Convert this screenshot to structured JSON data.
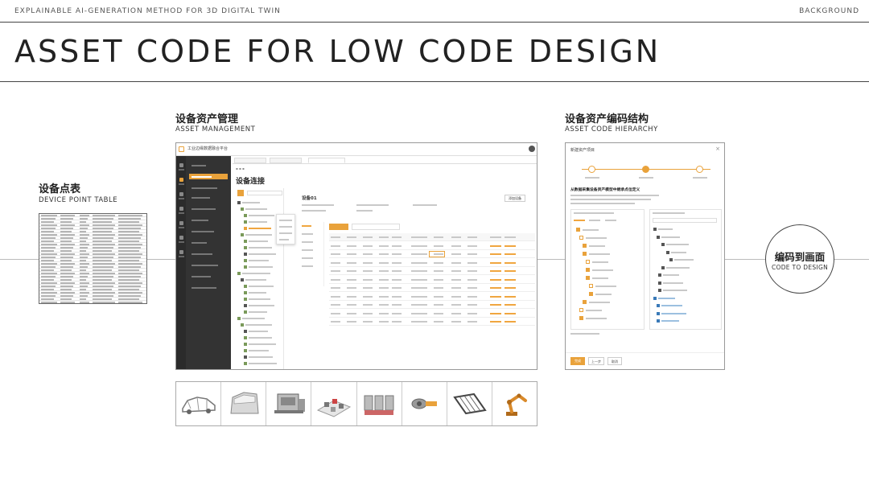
{
  "header": {
    "subtitle": "EXPLAINABLE AI-GENERATION METHOD FOR 3D DIGITAL TWIN",
    "section": "BACKGROUND",
    "title": "ASSET CODE FOR LOW CODE DESIGN"
  },
  "device_point_table": {
    "label_cn": "设备点表",
    "label_en": "DEVICE POINT TABLE"
  },
  "asset_management": {
    "label_cn": "设备资产管理",
    "label_en": "ASSET MANAGEMENT",
    "app_title": "工业边缘数据融合平台",
    "page_title": "设备连接",
    "device_name": "设备01",
    "connect_button": "添加设备",
    "table_rows": 9
  },
  "asset_code_hierarchy": {
    "label_cn": "设备资产编码结构",
    "label_en": "ASSET CODE HIERARCHY",
    "dialog_title": "新建资产项目",
    "heading": "从数据采集设备资产模型中继承点位定义",
    "footer_primary": "完成",
    "footer_secondary": "上一步",
    "footer_tertiary": "取消"
  },
  "code_to_design": {
    "label_cn": "编码到画面",
    "label_en": "CODE TO DESIGN"
  },
  "thumbnails": [
    "car-body-icon",
    "car-door-icon",
    "press-machine-icon",
    "assembly-line-icon",
    "furnace-array-icon",
    "motor-icon",
    "conveyor-rack-icon",
    "robot-arm-icon"
  ],
  "colors": {
    "accent": "#e9a23b",
    "dark": "#2b2b2b"
  }
}
